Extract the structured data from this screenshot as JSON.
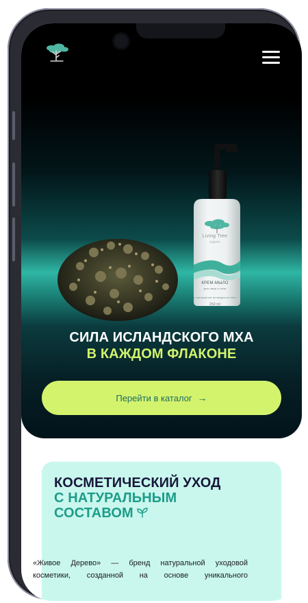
{
  "hero": {
    "bottle": {
      "brand": "Living Tree",
      "sub": "organic",
      "product": "КРЕМ-МЫЛО",
      "product_sub": "для лица и тела",
      "desc": "с экстрактом исландского мха",
      "volume": "250 ml"
    },
    "title_line1": "СИЛА ИСЛАНДСКОГО МХА",
    "title_line2": "В КАЖДОМ ФЛАКОНЕ",
    "cta_label": "Перейти в каталог",
    "cta_arrow": "→"
  },
  "about": {
    "title_line1": "КОСМЕТИЧЕСКИЙ УХОД",
    "title_line2": "С НАТУРАЛЬНЫМ",
    "title_line3": "СОСТАВОМ",
    "paragraph_line1": "«Живое Дерево» — бренд натуральной уходовой",
    "paragraph_line2": "косметики, созданной на основе уникального"
  },
  "colors": {
    "accent_lime": "#d3f36d",
    "accent_teal": "#1e9c88",
    "card_bg": "#c9f7ee",
    "dark_text": "#17173a"
  },
  "icons": {
    "logo": "tree-logo-icon",
    "menu": "hamburger-menu-icon",
    "sprout": "sprout-leaf-icon",
    "arrow": "arrow-right-icon"
  }
}
